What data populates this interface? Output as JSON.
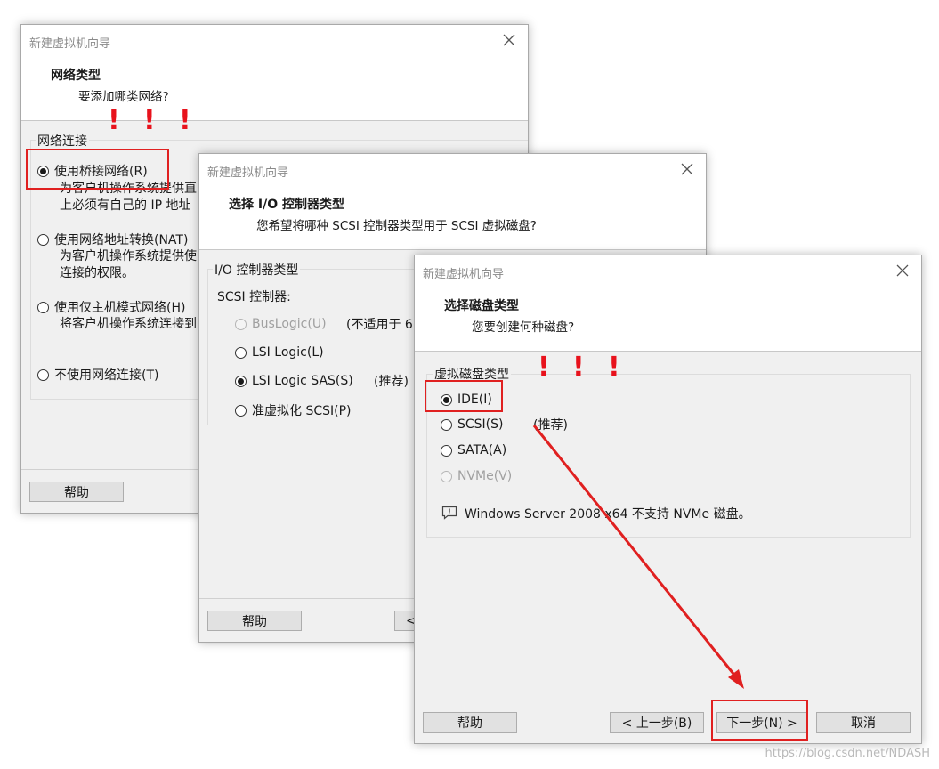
{
  "dialog1": {
    "title": "新建虚拟机向导",
    "heading": "网络类型",
    "subheading": "要添加哪类网络?",
    "group_label": "网络连接",
    "options": [
      {
        "label": "使用桥接网络(R)",
        "desc": [
          "为客户机操作系统提供直",
          "上必须有自己的 IP 地址"
        ],
        "selected": true
      },
      {
        "label": "使用网络地址转换(NAT)",
        "desc": [
          "为客户机操作系统提供使",
          "连接的权限。"
        ],
        "selected": false
      },
      {
        "label": "使用仅主机模式网络(H)",
        "desc": [
          "将客户机操作系统连接到"
        ],
        "selected": false
      },
      {
        "label": "不使用网络连接(T)",
        "desc": [],
        "selected": false
      }
    ],
    "help_label": "帮助"
  },
  "dialog2": {
    "title": "新建虚拟机向导",
    "heading": "选择 I/O 控制器类型",
    "subheading": "您希望将哪种 SCSI 控制器类型用于 SCSI 虚拟磁盘?",
    "group_label": "I/O 控制器类型",
    "scsi_label": "SCSI 控制器:",
    "options": [
      {
        "label": "BusLogic(U)",
        "note": "(不适用于 6",
        "disabled": true,
        "selected": false
      },
      {
        "label": "LSI Logic(L)",
        "note": "",
        "disabled": false,
        "selected": false
      },
      {
        "label": "LSI Logic SAS(S)",
        "note": "(推荐)",
        "disabled": false,
        "selected": true
      },
      {
        "label": "准虚拟化 SCSI(P)",
        "note": "",
        "disabled": false,
        "selected": false
      }
    ],
    "help_label": "帮助",
    "back_partial": "<"
  },
  "dialog3": {
    "title": "新建虚拟机向导",
    "heading": "选择磁盘类型",
    "subheading": "您要创建何种磁盘?",
    "group_label": "虚拟磁盘类型",
    "options": [
      {
        "label": "IDE(I)",
        "note": "",
        "disabled": false,
        "selected": true
      },
      {
        "label": "SCSI(S)",
        "note": "(推荐)",
        "disabled": false,
        "selected": false
      },
      {
        "label": "SATA(A)",
        "note": "",
        "disabled": false,
        "selected": false
      },
      {
        "label": "NVMe(V)",
        "note": "",
        "disabled": true,
        "selected": false
      }
    ],
    "info_text": "Windows Server 2008 x64 不支持 NVMe 磁盘。",
    "help_label": "帮助",
    "back_label": "< 上一步(B)",
    "next_label": "下一步(N) >",
    "cancel_label": "取消"
  },
  "annotations": {
    "exclamation": "!",
    "arrow_color": "#e02020",
    "box_color": "#e02020"
  },
  "watermark": "https://blog.csdn.net/NDASH"
}
